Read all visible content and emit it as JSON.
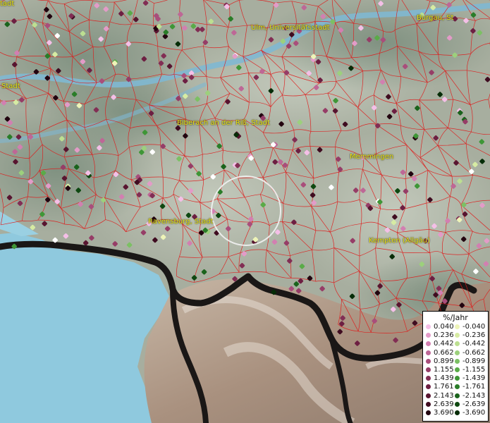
{
  "places": [
    {
      "name": "Ulm, Universitätsstadt"
    },
    {
      "name": "Burgau, St"
    },
    {
      "name": "Stadt"
    },
    {
      "name": "Biberach an der Riß, Stadt"
    },
    {
      "name": "Memmingen"
    },
    {
      "name": "Ravensburg, Stadt"
    },
    {
      "name": "Kempten (Allgäu)"
    },
    {
      "name": "tadt"
    }
  ],
  "legend": {
    "title": "%/Jahr",
    "positive": [
      {
        "value": "0.040",
        "color": "#f4bfe7"
      },
      {
        "value": "0.236",
        "color": "#e39bc8"
      },
      {
        "value": "0.442",
        "color": "#d27fb1"
      },
      {
        "value": "0.662",
        "color": "#be6796"
      },
      {
        "value": "0.899",
        "color": "#a94e7b"
      },
      {
        "value": "1.155",
        "color": "#963d67"
      },
      {
        "value": "1.439",
        "color": "#822e54"
      },
      {
        "value": "1.761",
        "color": "#6d1f42"
      },
      {
        "value": "2.143",
        "color": "#581530"
      },
      {
        "value": "2.639",
        "color": "#3f0c20"
      },
      {
        "value": "3.690",
        "color": "#22040f"
      }
    ],
    "negative": [
      {
        "value": "-0.040",
        "color": "#eef4b8"
      },
      {
        "value": "-0.236",
        "color": "#d6eba3"
      },
      {
        "value": "-0.442",
        "color": "#bcdf91"
      },
      {
        "value": "-0.662",
        "color": "#9cd07c"
      },
      {
        "value": "-0.899",
        "color": "#7cc064"
      },
      {
        "value": "-1.155",
        "color": "#5aab48"
      },
      {
        "value": "-1.439",
        "color": "#3f9637"
      },
      {
        "value": "-1.761",
        "color": "#2a7d29"
      },
      {
        "value": "-2.143",
        "color": "#1a631c"
      },
      {
        "value": "-2.639",
        "color": "#0e4811"
      },
      {
        "value": "-3.690",
        "color": "#062c07"
      }
    ]
  },
  "colors": {
    "boundary": "#e01818",
    "lake": "#8fc9de",
    "label": "#e9e31a",
    "highlight_circle": "#f2f2f2"
  }
}
